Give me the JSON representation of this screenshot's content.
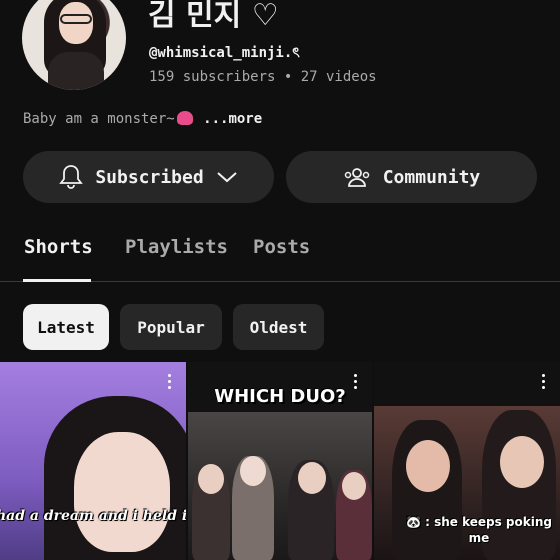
{
  "channel": {
    "name": "김 민지 ♡",
    "handle": "@whimsical_minji.ৎ",
    "stats": "159 subscribers • 27 videos",
    "description": "Baby am a monster~",
    "more_label": "...more"
  },
  "actions": {
    "subscribed_label": "Subscribed",
    "community_label": "Community"
  },
  "tabs": [
    {
      "label": "Shorts",
      "active": true
    },
    {
      "label": "Playlists",
      "active": false
    },
    {
      "label": "Posts",
      "active": false
    }
  ],
  "filters": [
    {
      "label": "Latest",
      "selected": true
    },
    {
      "label": "Popular",
      "selected": false
    },
    {
      "label": "Oldest",
      "selected": false
    }
  ],
  "shorts": [
    {
      "caption": "had a dream and i held it tig"
    },
    {
      "title": "WHICH DUO?"
    },
    {
      "caption": "🐼 : she keeps poking me"
    }
  ],
  "icons": {
    "bell": "bell-icon",
    "chevron": "chevron-down-icon",
    "community": "people-icon",
    "kebab": "more-vert-icon"
  },
  "colors": {
    "background": "#0f0f0f",
    "button_bg": "#272727",
    "selected_chip_bg": "#f1f1f1",
    "secondary_text": "#aaaaaa"
  }
}
